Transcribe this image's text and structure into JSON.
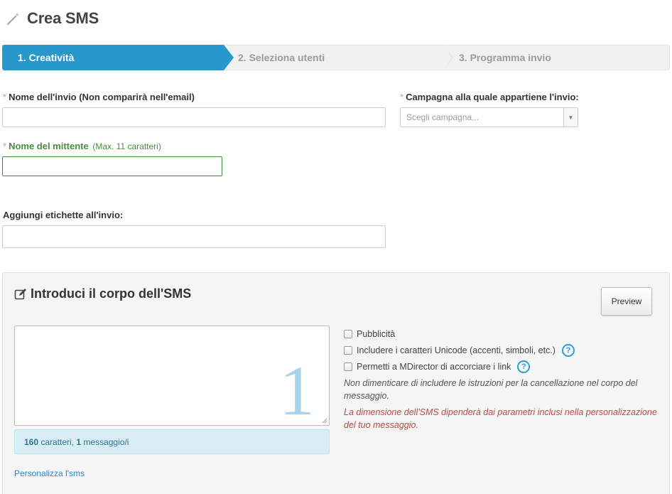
{
  "header": {
    "title": "Crea SMS",
    "icon": "magic-wand-icon"
  },
  "steps": [
    {
      "label": "1. Creatività",
      "active": true
    },
    {
      "label": "2. Seleziona utenti",
      "active": false
    },
    {
      "label": "3. Programma invio",
      "active": false
    }
  ],
  "form": {
    "required_mark": "*",
    "name_label": "Nome dell'invio (Non comparirà nell'email)",
    "name_value": "",
    "campaign_label": "Campagna alla quale appartiene l'invio:",
    "campaign_placeholder": "Scegli campagna...",
    "sender_label": "Nome del mittente",
    "sender_hint": "(Max. 11 caratteri)",
    "sender_value": "",
    "tags_label": "Aggiungi etichette all'invio:",
    "tags_value": ""
  },
  "sms_panel": {
    "title": "Introduci il corpo dell'SMS",
    "preview_label": "Preview",
    "message_count_display": "1",
    "info": {
      "chars": "160",
      "chars_text": " caratteri, ",
      "messages": "1",
      "messages_text": " messaggio/i"
    },
    "personalize_link": "Personalizza l'sms",
    "options": [
      {
        "label": "Pubblicità",
        "checked": false,
        "help": false
      },
      {
        "label": "Includere i caratteri Unicode (accenti, simboli, etc.)",
        "checked": false,
        "help": true
      },
      {
        "label": "Permetti a MDirector di accorciare i link",
        "checked": false,
        "help": true
      }
    ],
    "help_symbol": "?",
    "note": "Non dimenticare di includere le istruzioni per la cancellazione nel corpo del messaggio.",
    "warning": "La dimensione dell'SMS dipenderà dai parametri inclusi nella personalizzazione del tuo messaggio."
  },
  "colors": {
    "accent": "#2897cc",
    "success": "#4a8b3c",
    "danger": "#b94a48",
    "info_bg": "#d9edf7"
  }
}
